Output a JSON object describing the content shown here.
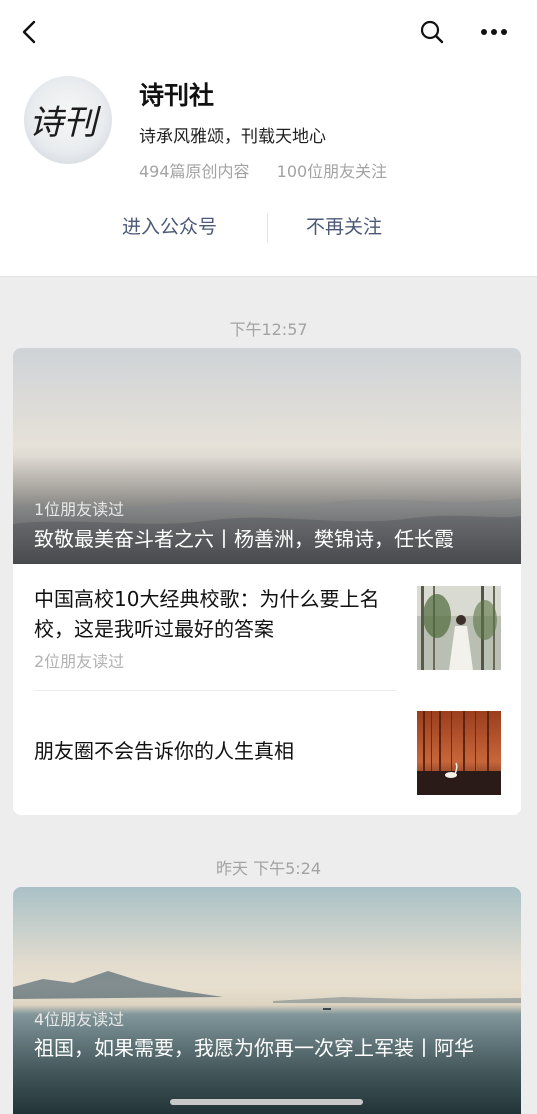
{
  "account": {
    "name": "诗刊社",
    "description": "诗承风雅颂，刊载天地心",
    "original_count": "494篇原创内容",
    "friends_following": "100位朋友关注",
    "logo_text": "诗刊",
    "enter_label": "进入公众号",
    "unfollow_label": "不再关注"
  },
  "icons": {
    "back": "chevron-left-icon",
    "search": "search-icon",
    "more": "ellipsis-icon"
  },
  "groups": [
    {
      "time": "下午12:57",
      "cover": {
        "read": "1位朋友读过",
        "title": "致敬最美奋斗者之六丨杨善洲，樊锦诗，任长霞"
      },
      "items": [
        {
          "title": "中国高校10大经典校歌：为什么要上名校，这是我听过最好的答案",
          "read": "2位朋友读过"
        },
        {
          "title": "朋友圈不会告诉你的人生真相",
          "read": ""
        }
      ]
    },
    {
      "time": "昨天 下午5:24",
      "cover": {
        "read": "4位朋友读过",
        "title": "祖国，如果需要，我愿为你再一次穿上军装丨阿华"
      }
    }
  ],
  "colors": {
    "link": "#4d5a77",
    "background": "#ededed",
    "muted": "#a3a3a3"
  }
}
